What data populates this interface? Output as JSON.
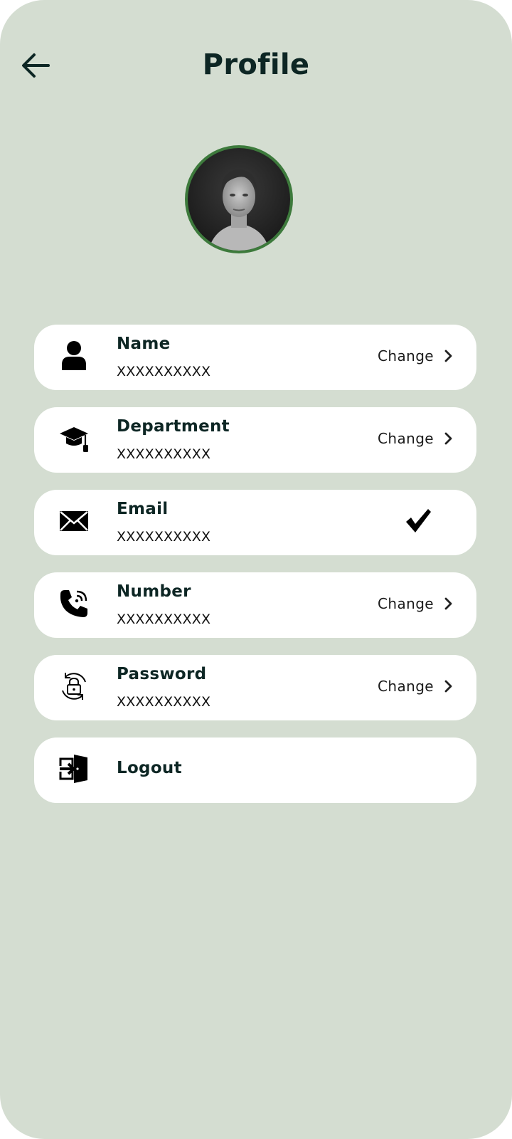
{
  "header": {
    "title": "Profile",
    "back_icon": "arrow-left-icon"
  },
  "colors": {
    "background": "#d4ddd1",
    "card": "#ffffff",
    "title_text": "#0d2624",
    "avatar_ring": "#3d7a3c"
  },
  "profile": {
    "avatar_icon": "profile-photo"
  },
  "fields": [
    {
      "label": "Name",
      "value": "XXXXXXXXXX",
      "action": "Change",
      "icon": "person-icon"
    },
    {
      "label": "Department",
      "value": "XXXXXXXXXX",
      "action": "Change",
      "icon": "graduation-cap-icon"
    },
    {
      "label": "Email",
      "value": "XXXXXXXXXX",
      "icon": "envelope-icon",
      "status_icon": "checkmark-icon"
    },
    {
      "label": "Number",
      "value": "XXXXXXXXXX",
      "action": "Change",
      "icon": "phone-icon"
    },
    {
      "label": "Password",
      "value": "XXXXXXXXXX",
      "action": "Change",
      "icon": "lock-refresh-icon"
    }
  ],
  "logout": {
    "label": "Logout",
    "icon": "logout-door-icon"
  }
}
